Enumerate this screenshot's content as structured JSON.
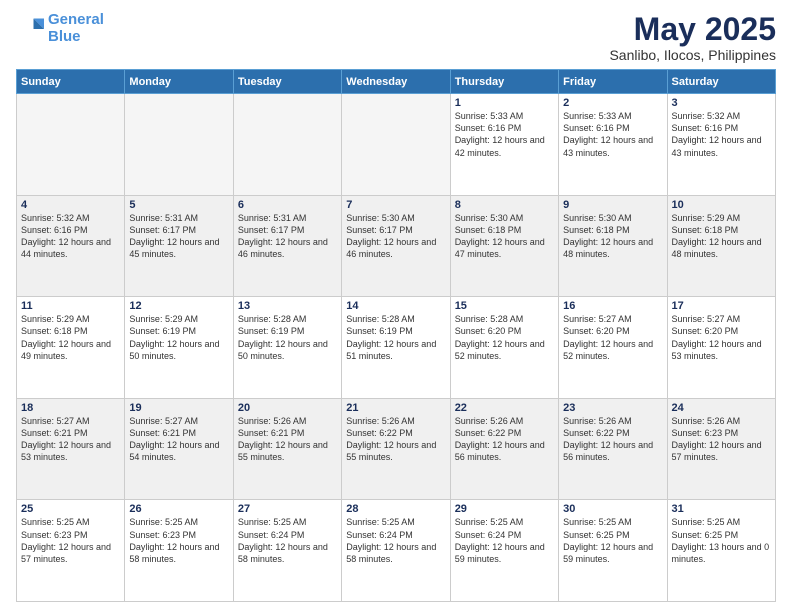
{
  "logo": {
    "line1": "General",
    "line2": "Blue"
  },
  "title": {
    "month_year": "May 2025",
    "location": "Sanlibo, Ilocos, Philippines"
  },
  "header": {
    "days": [
      "Sunday",
      "Monday",
      "Tuesday",
      "Wednesday",
      "Thursday",
      "Friday",
      "Saturday"
    ]
  },
  "weeks": [
    [
      {
        "day": "",
        "sunrise": "",
        "sunset": "",
        "daylight": "",
        "empty": true
      },
      {
        "day": "",
        "sunrise": "",
        "sunset": "",
        "daylight": "",
        "empty": true
      },
      {
        "day": "",
        "sunrise": "",
        "sunset": "",
        "daylight": "",
        "empty": true
      },
      {
        "day": "",
        "sunrise": "",
        "sunset": "",
        "daylight": "",
        "empty": true
      },
      {
        "day": "1",
        "sunrise": "Sunrise: 5:33 AM",
        "sunset": "Sunset: 6:16 PM",
        "daylight": "Daylight: 12 hours and 42 minutes."
      },
      {
        "day": "2",
        "sunrise": "Sunrise: 5:33 AM",
        "sunset": "Sunset: 6:16 PM",
        "daylight": "Daylight: 12 hours and 43 minutes."
      },
      {
        "day": "3",
        "sunrise": "Sunrise: 5:32 AM",
        "sunset": "Sunset: 6:16 PM",
        "daylight": "Daylight: 12 hours and 43 minutes."
      }
    ],
    [
      {
        "day": "4",
        "sunrise": "Sunrise: 5:32 AM",
        "sunset": "Sunset: 6:16 PM",
        "daylight": "Daylight: 12 hours and 44 minutes."
      },
      {
        "day": "5",
        "sunrise": "Sunrise: 5:31 AM",
        "sunset": "Sunset: 6:17 PM",
        "daylight": "Daylight: 12 hours and 45 minutes."
      },
      {
        "day": "6",
        "sunrise": "Sunrise: 5:31 AM",
        "sunset": "Sunset: 6:17 PM",
        "daylight": "Daylight: 12 hours and 46 minutes."
      },
      {
        "day": "7",
        "sunrise": "Sunrise: 5:30 AM",
        "sunset": "Sunset: 6:17 PM",
        "daylight": "Daylight: 12 hours and 46 minutes."
      },
      {
        "day": "8",
        "sunrise": "Sunrise: 5:30 AM",
        "sunset": "Sunset: 6:18 PM",
        "daylight": "Daylight: 12 hours and 47 minutes."
      },
      {
        "day": "9",
        "sunrise": "Sunrise: 5:30 AM",
        "sunset": "Sunset: 6:18 PM",
        "daylight": "Daylight: 12 hours and 48 minutes."
      },
      {
        "day": "10",
        "sunrise": "Sunrise: 5:29 AM",
        "sunset": "Sunset: 6:18 PM",
        "daylight": "Daylight: 12 hours and 48 minutes."
      }
    ],
    [
      {
        "day": "11",
        "sunrise": "Sunrise: 5:29 AM",
        "sunset": "Sunset: 6:18 PM",
        "daylight": "Daylight: 12 hours and 49 minutes."
      },
      {
        "day": "12",
        "sunrise": "Sunrise: 5:29 AM",
        "sunset": "Sunset: 6:19 PM",
        "daylight": "Daylight: 12 hours and 50 minutes."
      },
      {
        "day": "13",
        "sunrise": "Sunrise: 5:28 AM",
        "sunset": "Sunset: 6:19 PM",
        "daylight": "Daylight: 12 hours and 50 minutes."
      },
      {
        "day": "14",
        "sunrise": "Sunrise: 5:28 AM",
        "sunset": "Sunset: 6:19 PM",
        "daylight": "Daylight: 12 hours and 51 minutes."
      },
      {
        "day": "15",
        "sunrise": "Sunrise: 5:28 AM",
        "sunset": "Sunset: 6:20 PM",
        "daylight": "Daylight: 12 hours and 52 minutes."
      },
      {
        "day": "16",
        "sunrise": "Sunrise: 5:27 AM",
        "sunset": "Sunset: 6:20 PM",
        "daylight": "Daylight: 12 hours and 52 minutes."
      },
      {
        "day": "17",
        "sunrise": "Sunrise: 5:27 AM",
        "sunset": "Sunset: 6:20 PM",
        "daylight": "Daylight: 12 hours and 53 minutes."
      }
    ],
    [
      {
        "day": "18",
        "sunrise": "Sunrise: 5:27 AM",
        "sunset": "Sunset: 6:21 PM",
        "daylight": "Daylight: 12 hours and 53 minutes."
      },
      {
        "day": "19",
        "sunrise": "Sunrise: 5:27 AM",
        "sunset": "Sunset: 6:21 PM",
        "daylight": "Daylight: 12 hours and 54 minutes."
      },
      {
        "day": "20",
        "sunrise": "Sunrise: 5:26 AM",
        "sunset": "Sunset: 6:21 PM",
        "daylight": "Daylight: 12 hours and 55 minutes."
      },
      {
        "day": "21",
        "sunrise": "Sunrise: 5:26 AM",
        "sunset": "Sunset: 6:22 PM",
        "daylight": "Daylight: 12 hours and 55 minutes."
      },
      {
        "day": "22",
        "sunrise": "Sunrise: 5:26 AM",
        "sunset": "Sunset: 6:22 PM",
        "daylight": "Daylight: 12 hours and 56 minutes."
      },
      {
        "day": "23",
        "sunrise": "Sunrise: 5:26 AM",
        "sunset": "Sunset: 6:22 PM",
        "daylight": "Daylight: 12 hours and 56 minutes."
      },
      {
        "day": "24",
        "sunrise": "Sunrise: 5:26 AM",
        "sunset": "Sunset: 6:23 PM",
        "daylight": "Daylight: 12 hours and 57 minutes."
      }
    ],
    [
      {
        "day": "25",
        "sunrise": "Sunrise: 5:25 AM",
        "sunset": "Sunset: 6:23 PM",
        "daylight": "Daylight: 12 hours and 57 minutes."
      },
      {
        "day": "26",
        "sunrise": "Sunrise: 5:25 AM",
        "sunset": "Sunset: 6:23 PM",
        "daylight": "Daylight: 12 hours and 58 minutes."
      },
      {
        "day": "27",
        "sunrise": "Sunrise: 5:25 AM",
        "sunset": "Sunset: 6:24 PM",
        "daylight": "Daylight: 12 hours and 58 minutes."
      },
      {
        "day": "28",
        "sunrise": "Sunrise: 5:25 AM",
        "sunset": "Sunset: 6:24 PM",
        "daylight": "Daylight: 12 hours and 58 minutes."
      },
      {
        "day": "29",
        "sunrise": "Sunrise: 5:25 AM",
        "sunset": "Sunset: 6:24 PM",
        "daylight": "Daylight: 12 hours and 59 minutes."
      },
      {
        "day": "30",
        "sunrise": "Sunrise: 5:25 AM",
        "sunset": "Sunset: 6:25 PM",
        "daylight": "Daylight: 12 hours and 59 minutes."
      },
      {
        "day": "31",
        "sunrise": "Sunrise: 5:25 AM",
        "sunset": "Sunset: 6:25 PM",
        "daylight": "Daylight: 13 hours and 0 minutes."
      }
    ]
  ]
}
